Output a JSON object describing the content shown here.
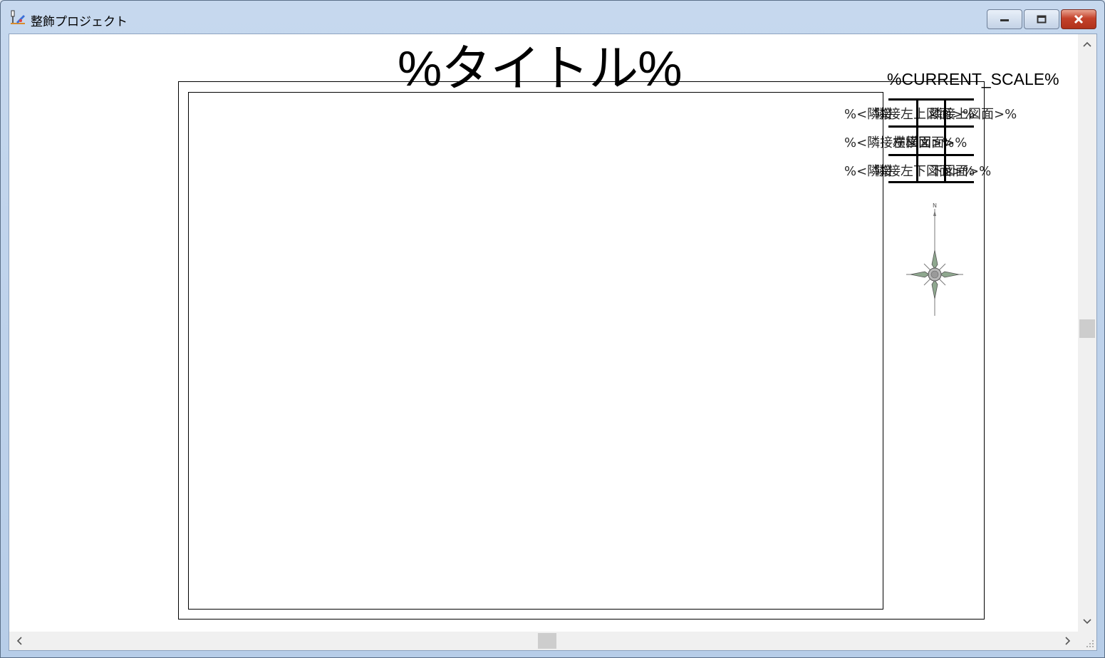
{
  "window": {
    "title": "整飾プロジェクト",
    "icons": {
      "app": "app-icon",
      "minimize": "minimize-icon",
      "maximize": "maximize-icon",
      "close": "close-icon"
    }
  },
  "drawing": {
    "title_placeholder": "%タイトル%",
    "scale_placeholder": "%CURRENT_SCALE%",
    "adjacent_labels": [
      {
        "text_a": "%<隣接",
        "text_b": "隣接左上図面>%",
        "text_c": "隣接上図面>%"
      },
      {
        "text_a": "%<隣接左横図面>%",
        "text_b": "横図面>%",
        "text_c": ""
      },
      {
        "text_a": "%<隣接",
        "text_b": "隣接左下図面>%",
        "text_c": "下図面>%"
      }
    ],
    "compass_letter": "N"
  },
  "scrollbars": {
    "icons": {
      "up": "scroll-up-icon",
      "down": "scroll-down-icon",
      "left": "scroll-left-icon",
      "right": "scroll-right-icon"
    }
  }
}
